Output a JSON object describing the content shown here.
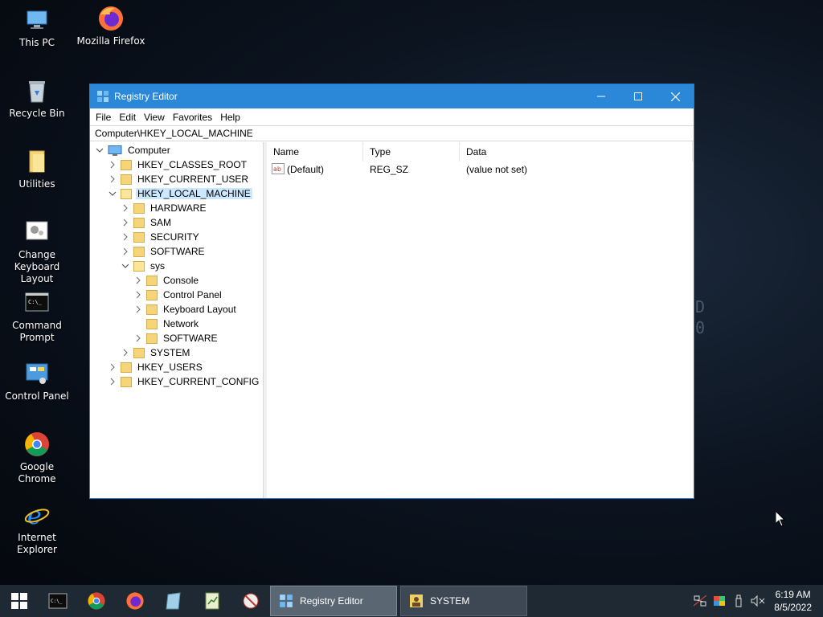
{
  "desktop": {
    "icons": [
      {
        "label": "This PC",
        "icon": "this-pc-icon"
      },
      {
        "label": "Mozilla Firefox",
        "icon": "firefox-icon"
      },
      {
        "label": "Recycle Bin",
        "icon": "recycle-bin-icon"
      },
      {
        "label": "Utilities",
        "icon": "folder-icon"
      },
      {
        "label": "Change Keyboard Layout",
        "icon": "keyboard-settings-icon"
      },
      {
        "label": "Command Prompt",
        "icon": "cmd-icon"
      },
      {
        "label": "Control Panel",
        "icon": "control-panel-icon"
      },
      {
        "label": "Google Chrome",
        "icon": "chrome-icon"
      },
      {
        "label": "Internet Explorer",
        "icon": "ie-icon"
      }
    ]
  },
  "window": {
    "title": "Registry Editor",
    "menu": [
      "File",
      "Edit",
      "View",
      "Favorites",
      "Help"
    ],
    "address": "Computer\\HKEY_LOCAL_MACHINE",
    "tree": [
      {
        "label": "Computer",
        "expanded": true
      },
      {
        "label": "HKEY_CLASSES_ROOT"
      },
      {
        "label": "HKEY_CURRENT_USER"
      },
      {
        "label": "HKEY_LOCAL_MACHINE",
        "expanded": true,
        "selected": true
      },
      {
        "label": "HARDWARE"
      },
      {
        "label": "SAM"
      },
      {
        "label": "SECURITY"
      },
      {
        "label": "SOFTWARE"
      },
      {
        "label": "sys",
        "expanded": true
      },
      {
        "label": "Console"
      },
      {
        "label": "Control Panel"
      },
      {
        "label": "Keyboard Layout"
      },
      {
        "label": "Network"
      },
      {
        "label": "SOFTWARE"
      },
      {
        "label": "SYSTEM"
      },
      {
        "label": "HKEY_USERS"
      },
      {
        "label": "HKEY_CURRENT_CONFIG"
      }
    ],
    "columns": [
      "Name",
      "Type",
      "Data"
    ],
    "values": [
      {
        "name": "(Default)",
        "type": "REG_SZ",
        "data": "(value not set)"
      }
    ]
  },
  "taskbar": {
    "tasks": [
      "Registry Editor",
      "SYSTEM"
    ],
    "clock_time": "6:19 AM",
    "clock_date": "8/5/2022"
  },
  "colors": {
    "titlebar": "#2b88d8",
    "selection": "#cce8ff",
    "folder": "#f5d57a"
  }
}
